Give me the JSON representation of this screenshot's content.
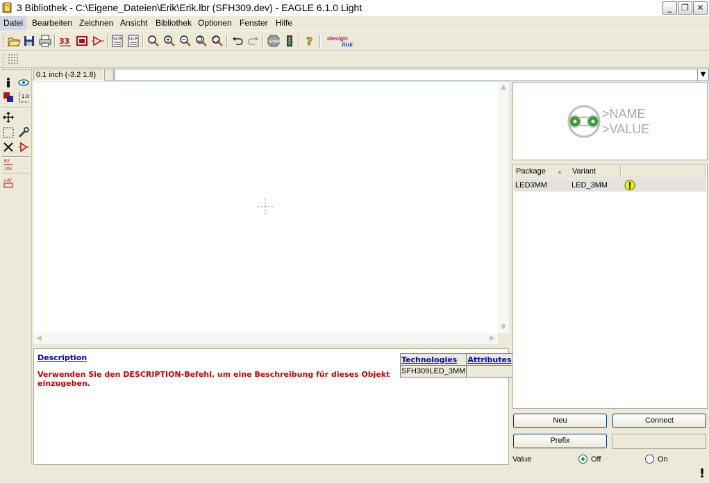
{
  "window": {
    "title": "3 Bibliothek - C:\\Eigene_Dateien\\Erik\\Erik.lbr (SFH309.dev) - EAGLE 6.1.0 Light"
  },
  "menu": [
    "Datei",
    "Bearbeiten",
    "Zeichnen",
    "Ansicht",
    "Bibliothek",
    "Optionen",
    "Fenster",
    "Hilfe"
  ],
  "coord": "0.1 inch (-3.2 1.8)",
  "command": {
    "value": ""
  },
  "description": {
    "title": "Description",
    "text": "Verwenden Sie den DESCRIPTION-Befehl, um eine Beschreibung für dieses Objekt einzugeben."
  },
  "tech_table": {
    "col1": "Technologies",
    "col2": "Attributes",
    "rows": [
      [
        "SFH309LED_3MM",
        ""
      ]
    ]
  },
  "preview": {
    "name": ">NAME",
    "value": ">VALUE"
  },
  "package_list": {
    "columns": [
      "Package",
      "Variant"
    ],
    "rows": [
      {
        "package": "LED3MM",
        "variant": "LED_3MM",
        "status": "warning"
      }
    ]
  },
  "buttons": {
    "neu": "Neu",
    "connect": "Connect",
    "prefix": "Prefix"
  },
  "value_mode": {
    "label": "Value",
    "off": "Off",
    "on": "On",
    "selected": "Off"
  },
  "toolbar": {
    "brand": "design link"
  },
  "layer_label": {
    "top": "R2",
    "bottom": "10k"
  },
  "status": {
    "indicator": "!"
  }
}
